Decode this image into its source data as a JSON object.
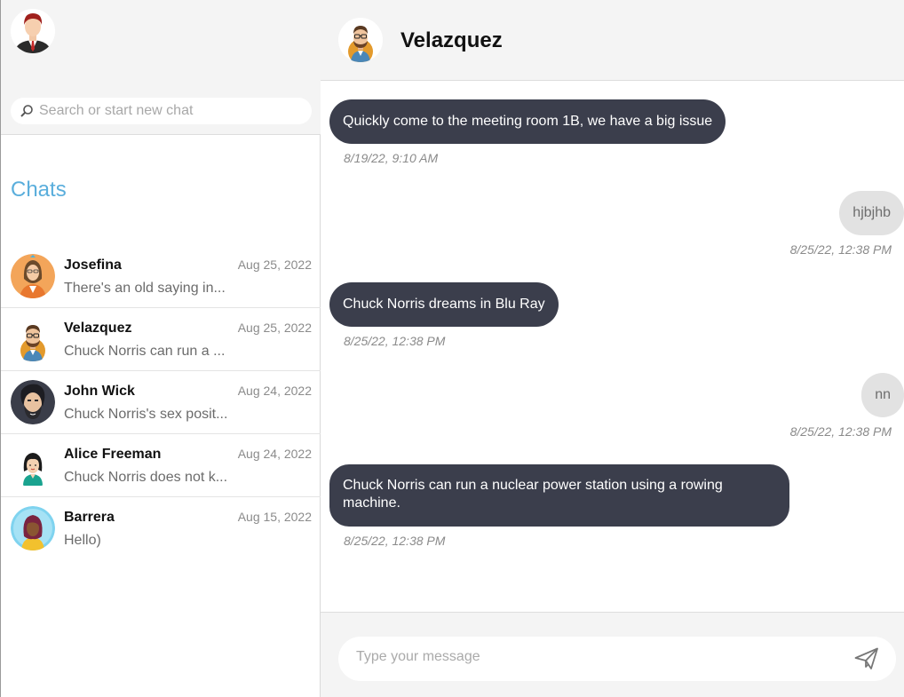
{
  "sidebar": {
    "me_avatar_icon": "user-avatar-man-red-hair-suit",
    "search": {
      "placeholder": "Search or start new chat",
      "icon": "search-icon"
    },
    "chats_title": "Chats",
    "chats": [
      {
        "name": "Josefina",
        "date": "Aug 25, 2022",
        "preview": "There's an old saying in...",
        "avatar": "avatar-josefina"
      },
      {
        "name": "Velazquez",
        "date": "Aug 25, 2022",
        "preview": "Chuck Norris can run a ...",
        "avatar": "avatar-velazquez"
      },
      {
        "name": "John Wick",
        "date": "Aug 24, 2022",
        "preview": "Chuck Norris's sex posit...",
        "avatar": "avatar-john-wick"
      },
      {
        "name": "Alice Freeman",
        "date": "Aug 24, 2022",
        "preview": "Chuck Norris does not k...",
        "avatar": "avatar-alice-freeman"
      },
      {
        "name": "Barrera",
        "date": "Aug 15, 2022",
        "preview": "Hello)",
        "avatar": "avatar-barrera"
      }
    ]
  },
  "conversation": {
    "name": "Velazquez",
    "avatar": "avatar-velazquez",
    "messages": [
      {
        "direction": "in",
        "text": "Quickly come to the meeting room 1B, we have a big issue",
        "time": "8/19/22, 9:10 AM"
      },
      {
        "direction": "out",
        "text": "hjbjhb",
        "time": "8/25/22, 12:38 PM"
      },
      {
        "direction": "in",
        "text": "Chuck Norris dreams in Blu Ray",
        "time": "8/25/22, 12:38 PM"
      },
      {
        "direction": "out",
        "text": "nn",
        "time": "8/25/22, 12:38 PM"
      },
      {
        "direction": "in",
        "text": "Chuck Norris can run a nuclear power station using a rowing machine.",
        "time": "8/25/22, 12:38 PM"
      }
    ],
    "composer": {
      "placeholder": "Type your message",
      "send_icon": "send-icon"
    }
  },
  "colors": {
    "accent": "#5aaedc",
    "incoming_bubble": "#3b3e4c",
    "outgoing_bubble": "#e2e2e2",
    "panel_bg": "#f4f4f4"
  }
}
